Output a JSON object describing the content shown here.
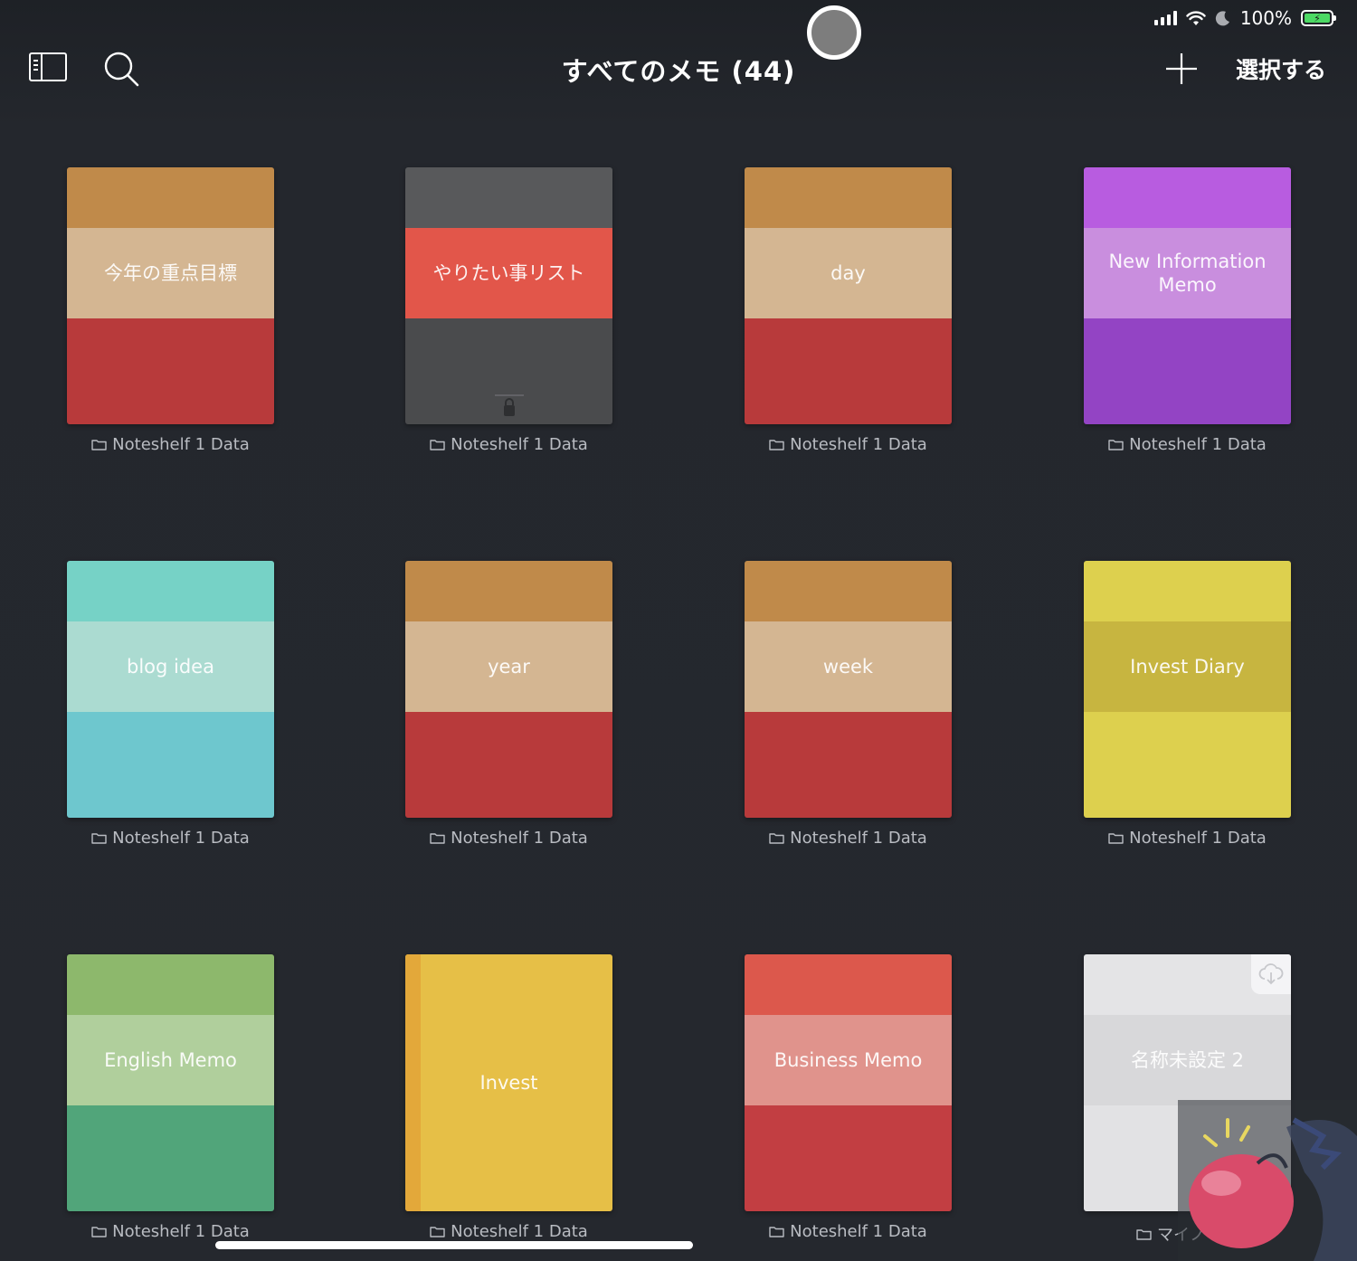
{
  "status_bar": {
    "battery_text": "100%",
    "battery_level": 1.0,
    "signal_bars": 4,
    "accent_battery": "#4cd964"
  },
  "nav": {
    "title": "すべてのメモ (44)",
    "select_label": "選択する",
    "icons": {
      "sidebar": "sidebar-toggle-icon",
      "search": "search-icon",
      "add": "plus-icon"
    }
  },
  "notebooks": [
    {
      "title": "今年の重点目標",
      "folder": "Noteshelf 1 Data",
      "colors": [
        "#c08a4a",
        "#d4b692",
        "#b83a3b"
      ]
    },
    {
      "title": "やりたい事リスト",
      "folder": "Noteshelf 1 Data",
      "colors": [
        "#58595b",
        "#e2564a",
        "#4a4b4d"
      ],
      "locked": true
    },
    {
      "title": "day",
      "folder": "Noteshelf 1 Data",
      "colors": [
        "#c08a4a",
        "#d4b692",
        "#b83a3b"
      ]
    },
    {
      "title": "New Information Memo",
      "folder": "Noteshelf 1 Data",
      "colors": [
        "#b85ce0",
        "#c98ede",
        "#9344c4"
      ]
    },
    {
      "title": "blog idea",
      "folder": "Noteshelf 1 Data",
      "colors": [
        "#76d2c6",
        "#abdbd1",
        "#6ec7ce"
      ]
    },
    {
      "title": "year",
      "folder": "Noteshelf 1 Data",
      "colors": [
        "#c08a4a",
        "#d4b692",
        "#b83a3b"
      ]
    },
    {
      "title": "week",
      "folder": "Noteshelf 1 Data",
      "colors": [
        "#c08a4a",
        "#d4b692",
        "#b83a3b"
      ]
    },
    {
      "title": "Invest Diary",
      "folder": "Noteshelf 1 Data",
      "colors": [
        "#ddd04e",
        "#c7b540",
        "#ddd04e"
      ]
    },
    {
      "title": "English Memo",
      "folder": "Noteshelf 1 Data",
      "colors": [
        "#8db86c",
        "#b0cf9c",
        "#51a57a"
      ]
    },
    {
      "title": "Invest",
      "folder": "Noteshelf 1 Data",
      "colors": [
        "#e6bf47",
        "#e6bf47",
        "#e6bf47"
      ],
      "plain": true
    },
    {
      "title": "Business Memo",
      "folder": "Noteshelf 1 Data",
      "colors": [
        "#dc584c",
        "#e0938c",
        "#c23e42"
      ]
    },
    {
      "title": "名称未設定 2",
      "folder": "マイノート",
      "colors": [
        "#e4e4e6",
        "#d8d8da",
        "#e2e2e4"
      ],
      "cloud": true
    }
  ]
}
